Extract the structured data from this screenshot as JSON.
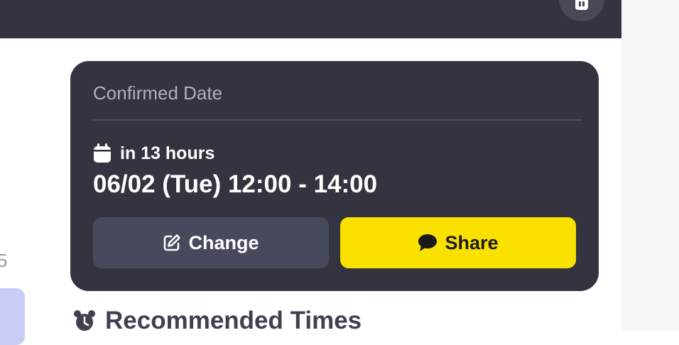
{
  "left_panel": {
    "partial_number": "5"
  },
  "confirmed_card": {
    "title": "Confirmed Date",
    "relative_time": "in 13 hours",
    "datetime": "06/02 (Tue) 12:00 - 14:00",
    "change_label": "Change",
    "share_label": "Share",
    "calendar_icon": "calendar-icon",
    "edit_icon": "edit-icon",
    "chat_icon": "chat-bubble-icon"
  },
  "section": {
    "heading": "Recommended Times",
    "icon": "alarm-clock-icon"
  },
  "colors": {
    "card_background": "#33343f",
    "share_button": "#fae100",
    "change_button": "#474a5c",
    "heading_text": "#3f4151"
  }
}
